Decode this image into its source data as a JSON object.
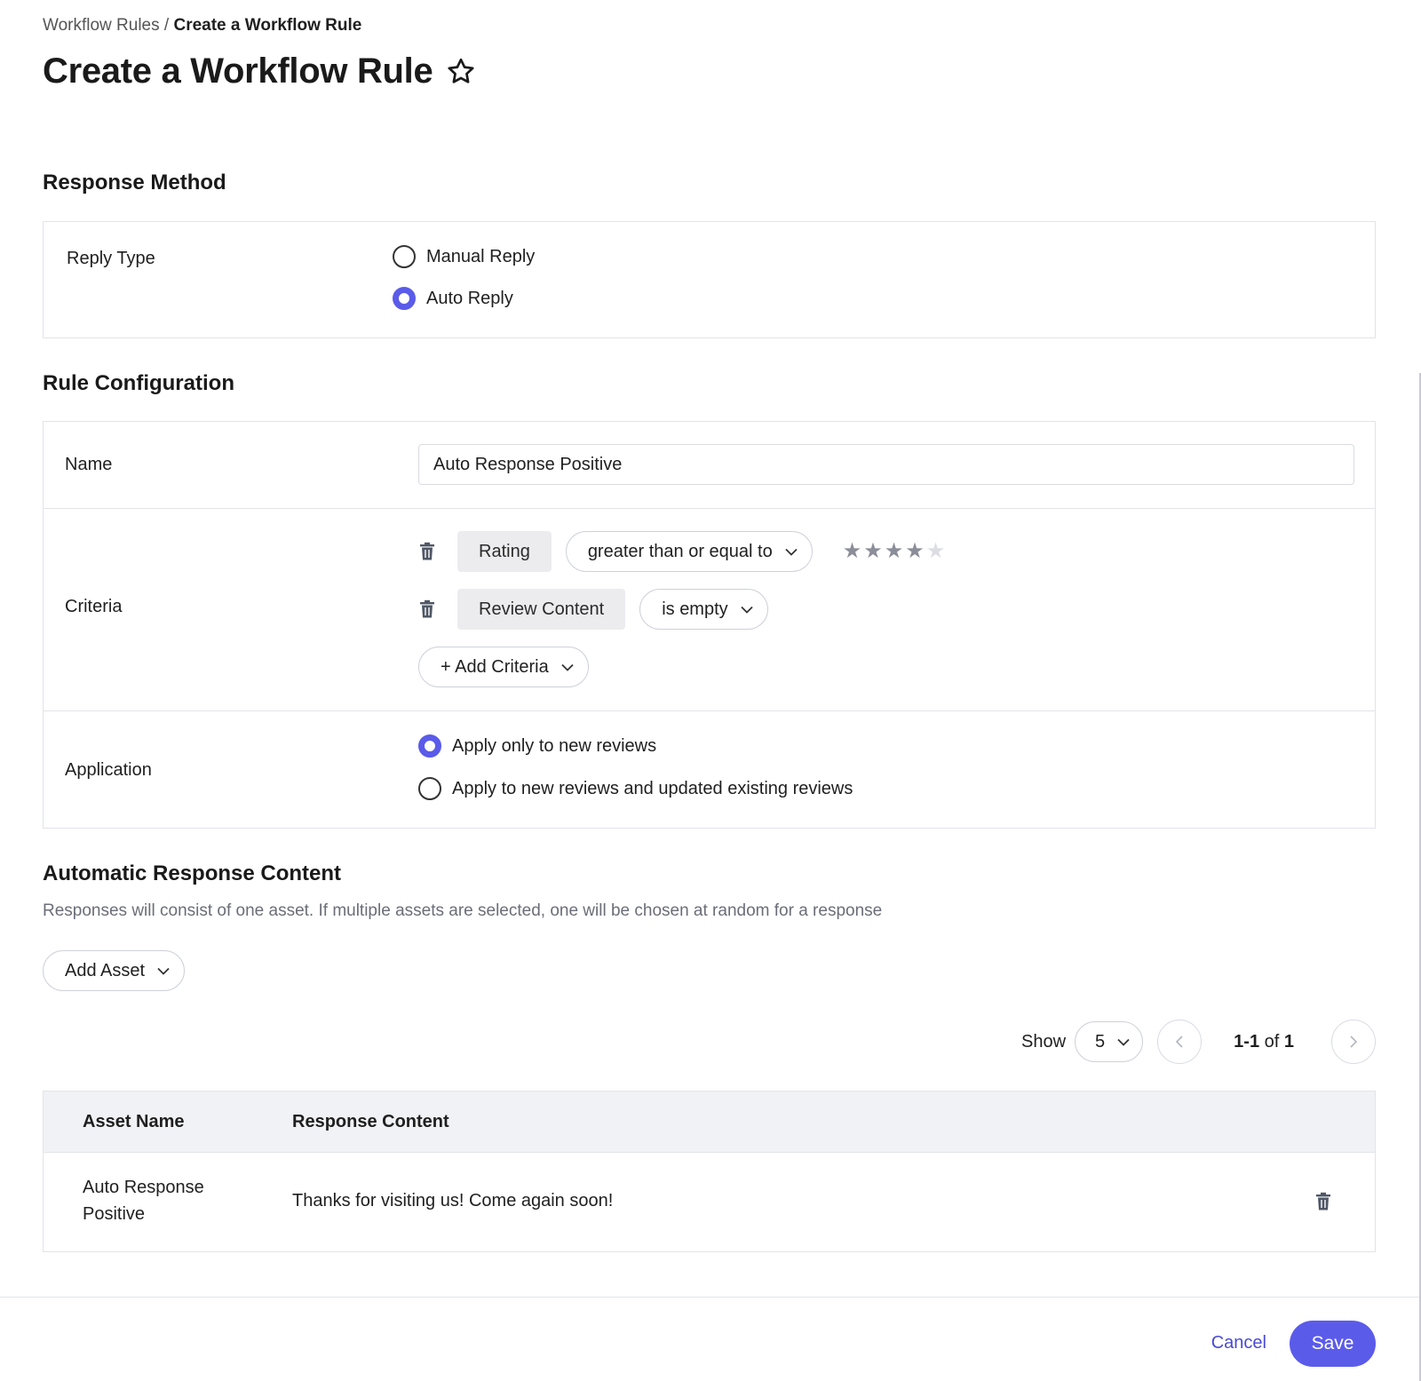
{
  "breadcrumb": {
    "parent": "Workflow Rules",
    "separator": " / ",
    "current": "Create a Workflow Rule"
  },
  "page": {
    "title": "Create a Workflow Rule"
  },
  "response_method": {
    "title": "Response Method",
    "reply_type_label": "Reply Type",
    "options": [
      {
        "label": "Manual Reply",
        "checked": false
      },
      {
        "label": "Auto Reply",
        "checked": true
      }
    ]
  },
  "rule_configuration": {
    "title": "Rule Configuration",
    "name_label": "Name",
    "name_value": "Auto Response Positive",
    "criteria_label": "Criteria",
    "criteria": [
      {
        "field": "Rating",
        "operator": "greater than or equal to",
        "rating_value": 4,
        "rating_max": 5
      },
      {
        "field": "Review Content",
        "operator": "is empty"
      }
    ],
    "add_criteria_label": "+ Add Criteria",
    "application_label": "Application",
    "application_options": [
      {
        "label": "Apply only to new reviews",
        "checked": true
      },
      {
        "label": "Apply to new reviews and updated existing reviews",
        "checked": false
      }
    ]
  },
  "auto_response": {
    "title": "Automatic Response Content",
    "description": "Responses will consist of one asset. If multiple assets are selected, one will be chosen at random for a response",
    "add_asset_label": "Add Asset"
  },
  "pagination": {
    "show_label": "Show",
    "page_size": "5",
    "range_start_end": "1-1",
    "of_label": "of",
    "total": "1"
  },
  "table": {
    "columns": [
      "Asset Name",
      "Response Content"
    ],
    "rows": [
      {
        "asset_name_line1": "Auto Response",
        "asset_name_line2": "Positive",
        "response_content": "Thanks for visiting us! Come again soon!"
      }
    ]
  },
  "footer": {
    "cancel_label": "Cancel",
    "save_label": "Save"
  },
  "colors": {
    "accent": "#5b5bea",
    "link": "#4a4ad6",
    "border": "#e3e4e8",
    "header_bg": "#f1f2f5"
  }
}
